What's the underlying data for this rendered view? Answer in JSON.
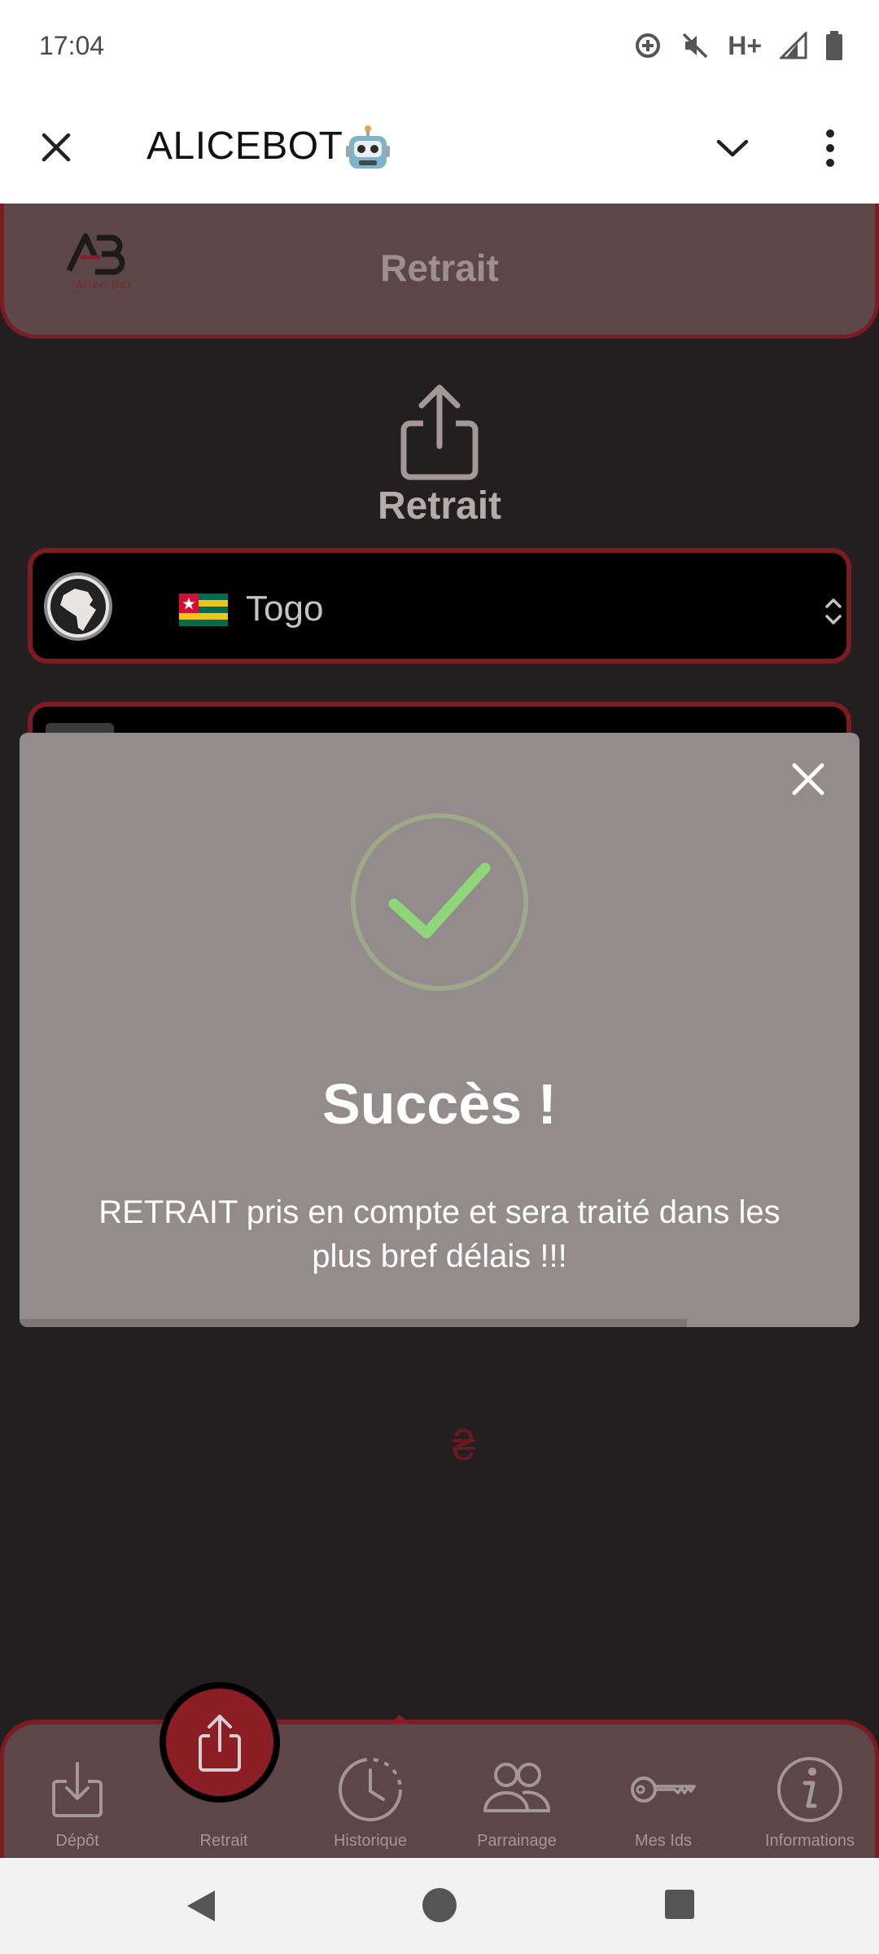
{
  "status_bar": {
    "time": "17:04",
    "network": "H+",
    "icons": [
      "data-saver-icon",
      "mute-icon",
      "signal-icon",
      "battery-icon"
    ]
  },
  "app_bar": {
    "title": "ALICEBOT",
    "icons": [
      "close-icon",
      "robot-emoji",
      "chevron-down-icon",
      "more-vert-icon"
    ]
  },
  "header": {
    "logo_text": "Alice Bot",
    "title": "Retrait"
  },
  "main": {
    "title": "Retrait",
    "country_select": {
      "value": "Togo",
      "icons": [
        "africa-globe-icon",
        "togo-flag-icon",
        "unfold-icon"
      ]
    },
    "currency_symbol": "₴"
  },
  "modal": {
    "title": "Succès !",
    "message": "RETRAIT pris en compte et sera traité dans les plus bref délais !!!",
    "timer_progress": 0.795,
    "icons": [
      "close-icon",
      "success-check-icon"
    ]
  },
  "bottom_nav": {
    "items": [
      {
        "label": "Dépôt",
        "icon": "download-tray-icon"
      },
      {
        "label": "Retrait",
        "icon": "upload-share-icon",
        "active": true
      },
      {
        "label": "Historique",
        "icon": "history-clock-icon"
      },
      {
        "label": "Parrainage",
        "icon": "people-icon"
      },
      {
        "label": "Mes Ids",
        "icon": "key-icon"
      },
      {
        "label": "Informations",
        "icon": "info-icon"
      }
    ]
  },
  "colors": {
    "background": "#231f20",
    "header": "#5c4648",
    "accent": "#7a1c22",
    "fab": "#8b1e24",
    "modal": "#938b8c",
    "success": "#8fd67a"
  }
}
